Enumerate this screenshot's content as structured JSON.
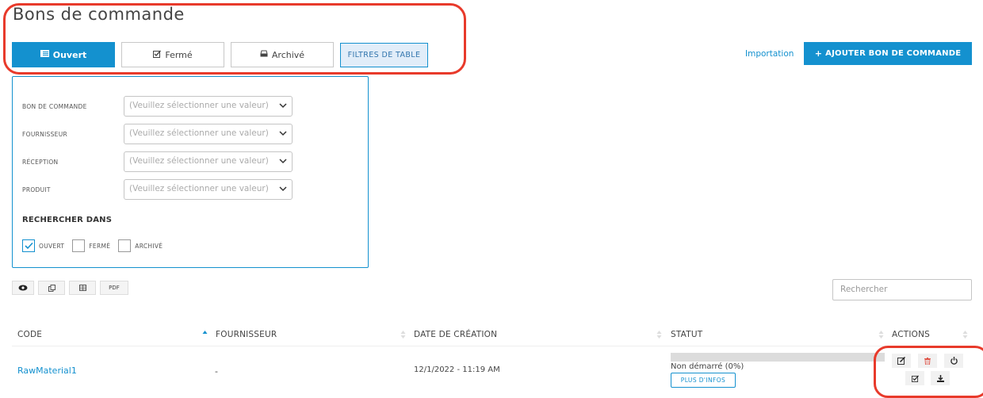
{
  "page": {
    "title": "Bons de commande"
  },
  "tabs": [
    {
      "label": "Ouvert",
      "icon": "list-icon",
      "active": true
    },
    {
      "label": "Fermé",
      "icon": "check-square-icon",
      "active": false
    },
    {
      "label": "Archivé",
      "icon": "inbox-icon",
      "active": false
    }
  ],
  "table_filters_label": "FILTRES DE TABLE",
  "header_actions": {
    "import_label": "Importation",
    "add_label": "AJOUTER BON DE COMMANDE",
    "add_icon": "plus-icon"
  },
  "filters": {
    "fields": [
      {
        "label": "BON DE COMMANDE",
        "placeholder": "(Veuillez sélectionner une valeur)"
      },
      {
        "label": "FOURNISSEUR",
        "placeholder": "(Veuillez sélectionner une valeur)"
      },
      {
        "label": "RÉCEPTION",
        "placeholder": "(Veuillez sélectionner une valeur)"
      },
      {
        "label": "PRODUIT",
        "placeholder": "(Veuillez sélectionner une valeur)"
      }
    ],
    "search_in_title": "RECHERCHER DANS",
    "search_in": [
      {
        "label": "OUVERT",
        "checked": true
      },
      {
        "label": "FERMÉ",
        "checked": false
      },
      {
        "label": "ARCHIVÉ",
        "checked": false
      }
    ]
  },
  "toolbar": [
    {
      "icon": "eye-icon"
    },
    {
      "icon": "copy-icon"
    },
    {
      "icon": "table-icon"
    },
    {
      "label": "PDF"
    }
  ],
  "search": {
    "placeholder": "Rechercher"
  },
  "table": {
    "columns": [
      "CODE",
      "FOURNISSEUR",
      "DATE DE CRÉATION",
      "STATUT",
      "ACTIONS"
    ],
    "rows": [
      {
        "code": "RawMaterial1",
        "supplier": "-",
        "created": "12/1/2022 - 11:19 AM",
        "status": "Non démarré (0%)",
        "progress": 0,
        "more_label": "PLUS D'INFOS"
      }
    ],
    "row_actions": [
      "edit-icon",
      "trash-icon",
      "power-icon",
      "check-square-icon",
      "download-icon"
    ]
  },
  "colors": {
    "accent": "#1491cf",
    "highlight": "#e83a2b",
    "danger": "#e05a4e"
  }
}
